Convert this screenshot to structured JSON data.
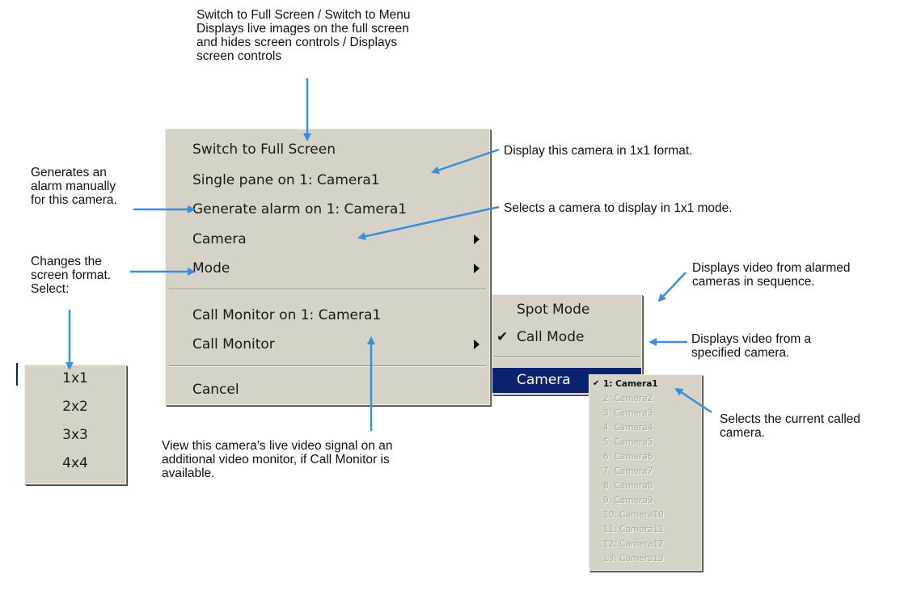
{
  "notes": {
    "top": "Switch to Full Screen / Switch to Menu\nDisplays live images on the full screen\nand hides screen controls / Displays\nscreen controls",
    "single_pane": "Display this camera in 1x1 format.",
    "generate_alarm": "Generates an\nalarm manually\nfor this camera.",
    "camera_select": "Selects a camera to display in 1x1 mode.",
    "mode": "Changes the\nscreen format.\nSelect:",
    "spot_mode": "Displays video from alarmed\ncameras in sequence.",
    "call_mode": "Displays video from a\n     specified camera.",
    "called_camera": "Selects the current called\ncamera.",
    "call_monitor": "View this camera’s live video signal on an\nadditional video monitor, if Call Monitor is\navailable."
  },
  "context_menu": {
    "items": [
      {
        "label": "Switch to Full Screen"
      },
      {
        "label": "Single pane on 1: Camera1"
      },
      {
        "label": "Generate alarm on 1: Camera1"
      },
      {
        "label": "Camera"
      },
      {
        "label": "Mode"
      },
      {
        "label": "Call Monitor on 1: Camera1"
      },
      {
        "label": "Call Monitor"
      },
      {
        "label": "Cancel"
      }
    ]
  },
  "mode_menu": {
    "items": [
      "1x1",
      "2x2",
      "3x3",
      "4x4"
    ]
  },
  "call_monitor_menu": {
    "items": [
      "Spot Mode",
      "Call Mode",
      "Camera"
    ],
    "checked": "Call Mode"
  },
  "camera_menu": {
    "items": [
      "1: Camera1",
      "2: Camera2",
      "3: Camera3",
      "4: Camera4",
      "5: Camera5",
      "6: Camera6",
      "7: Camera7",
      "8: Camera8",
      "9: Camera9",
      "10: Camera10",
      "11: Camera11",
      "12: Camera12",
      "13: Camera13"
    ],
    "checked": "1: Camera1"
  },
  "colors": {
    "menu_bg": "#d6d2c8",
    "highlight": "#0b2270",
    "callout_arrow": "#3a8fd8"
  }
}
